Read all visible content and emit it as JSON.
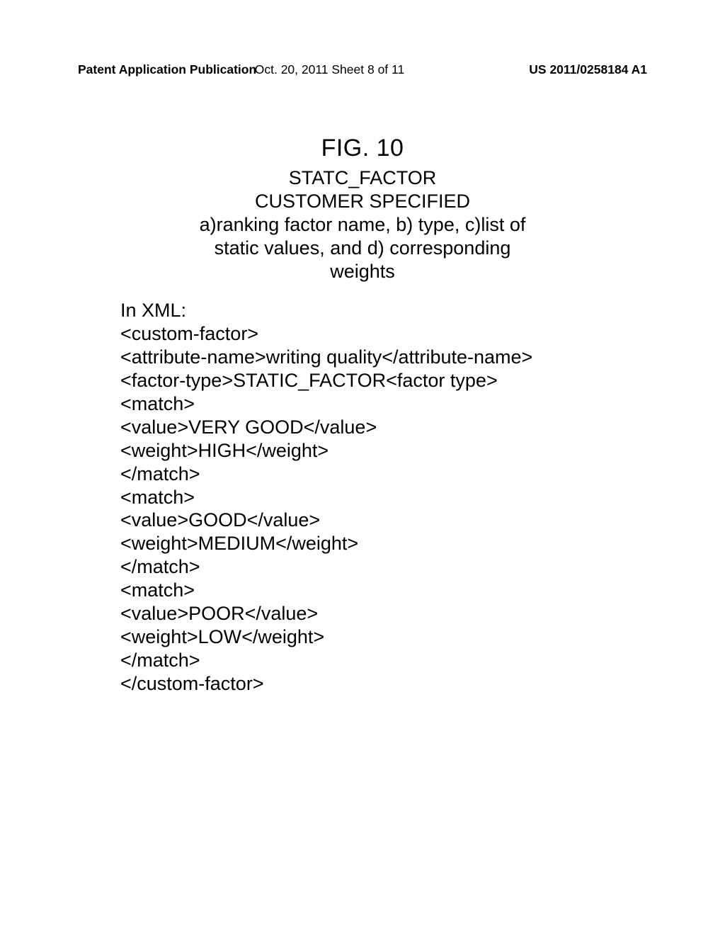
{
  "header": {
    "left": "Patent Application Publication",
    "center": "Oct. 20, 2011  Sheet 8 of 11",
    "right": "US 2011/0258184 A1"
  },
  "figure": {
    "title": "FIG. 10",
    "subtitle1": "STATC_FACTOR",
    "subtitle2": "CUSTOMER SPECIFIED",
    "subtitle3": "a)ranking factor name, b) type, c)list of",
    "subtitle4": "static values, and d) corresponding",
    "subtitle5": "weights"
  },
  "xml": {
    "lines": [
      "In XML:",
      "<custom-factor>",
      "<attribute-name>writing quality</attribute-name>",
      "<factor-type>STATIC_FACTOR<factor type>",
      "<match>",
      "<value>VERY GOOD</value>",
      "<weight>HIGH</weight>",
      "</match>",
      "<match>",
      "<value>GOOD</value>",
      "<weight>MEDIUM</weight>",
      "</match>",
      "<match>",
      "<value>POOR</value>",
      "<weight>LOW</weight>",
      "</match>",
      "</custom-factor>"
    ]
  }
}
